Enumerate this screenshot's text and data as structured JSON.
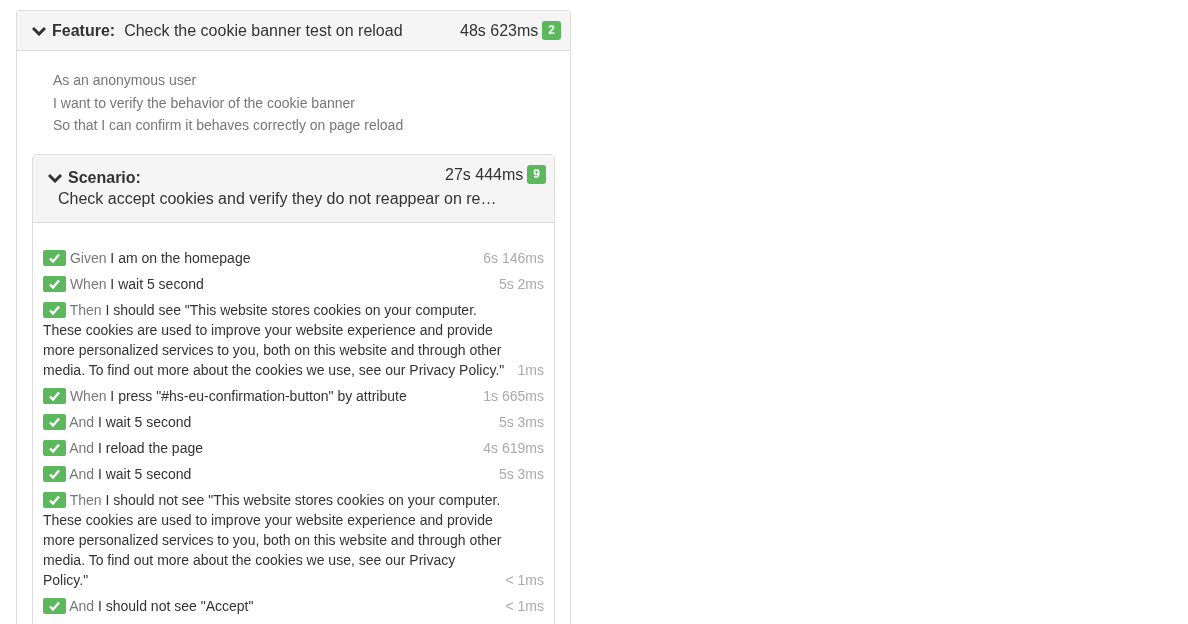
{
  "feature": {
    "label": "Feature:",
    "title": "Check the cookie banner test on reload",
    "duration": "48s 623ms",
    "count": "2",
    "expanded": true,
    "description": [
      "As an anonymous user",
      "I want to verify the behavior of the cookie banner",
      "So that I can confirm it behaves correctly on page reload"
    ],
    "scenario": {
      "label": "Scenario:",
      "title": "Check accept cookies and verify they do not reappear on re…",
      "duration": "27s 444ms",
      "count": "9",
      "expanded": true,
      "steps": [
        {
          "keyword": "Given",
          "text": "I am on the homepage",
          "duration": "6s 146ms",
          "passed": true
        },
        {
          "keyword": "When",
          "text": "I wait 5 second",
          "duration": "5s 2ms",
          "passed": true
        },
        {
          "keyword": "Then",
          "text": "I should see \"This website stores cookies on your computer. These cookies are used to improve your website experience and provide more personalized services to you, both on this website and through other media. To find out more about the cookies we use, see our Privacy Policy.\"",
          "duration": "1ms",
          "passed": true
        },
        {
          "keyword": "When",
          "text": "I press \"#hs-eu-confirmation-button\" by attribute",
          "duration": "1s 665ms",
          "passed": true
        },
        {
          "keyword": "And",
          "text": "I wait 5 second",
          "duration": "5s 3ms",
          "passed": true
        },
        {
          "keyword": "And",
          "text": "I reload the page",
          "duration": "4s 619ms",
          "passed": true
        },
        {
          "keyword": "And",
          "text": "I wait 5 second",
          "duration": "5s 3ms",
          "passed": true
        },
        {
          "keyword": "Then",
          "text": "I should not see \"This website stores cookies on your computer. These cookies are used to improve your website experience and provide more personalized services to you, both on this website and through other media. To find out more about the cookies we use, see our Privacy Policy.\"",
          "duration": "< 1ms",
          "passed": true
        },
        {
          "keyword": "And",
          "text": "I should not see \"Accept\"",
          "duration": "< 1ms",
          "passed": true
        }
      ]
    }
  }
}
